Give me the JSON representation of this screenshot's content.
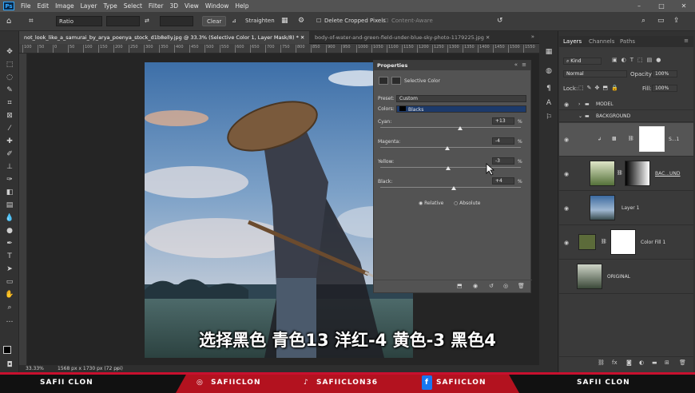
{
  "menubar": {
    "logo": "Ps",
    "items": [
      "File",
      "Edit",
      "Image",
      "Layer",
      "Type",
      "Select",
      "Filter",
      "3D",
      "View",
      "Window",
      "Help"
    ]
  },
  "options": {
    "ratio": "Ratio",
    "clear": "Clear",
    "straighten": "Straighten",
    "delete_cropped": "Delete Cropped Pixels",
    "content_aware": "Content-Aware"
  },
  "tabs": [
    "not_look_like_a_samurai_by_arya_poenya_stock_d1b8elly.jpg @ 33.3% (Selective Color 1, Layer Mask/8) *",
    "body-of-water-and-green-field-under-blue-sky-photo-1179225.jpg"
  ],
  "ruler": [
    "100",
    "50",
    "0",
    "50",
    "100",
    "150",
    "200",
    "250",
    "300",
    "350",
    "400",
    "450",
    "500",
    "550",
    "600",
    "650",
    "700",
    "750",
    "800",
    "850",
    "900",
    "950",
    "1000",
    "1050",
    "1100",
    "1150",
    "1200",
    "1250",
    "1300",
    "1350",
    "1400",
    "1450",
    "1500",
    "1550"
  ],
  "status": {
    "zoom": "33.33%",
    "doc": "1568 px x 1730 px (72 ppi)"
  },
  "properties": {
    "title": "Properties",
    "adj_name": "Selective Color",
    "preset_label": "Preset:",
    "preset_value": "Custom",
    "colors_label": "Colors:",
    "colors_value": "Blacks",
    "sliders": [
      {
        "label": "Cyan:",
        "value": "+13",
        "unit": "%",
        "pos": 0.57
      },
      {
        "label": "Magenta:",
        "value": "-4",
        "unit": "%",
        "pos": 0.48
      },
      {
        "label": "Yellow:",
        "value": "-3",
        "unit": "%",
        "pos": 0.485
      },
      {
        "label": "Black:",
        "value": "+4",
        "unit": "%",
        "pos": 0.52
      }
    ],
    "relative": "Relative",
    "absolute": "Absolute"
  },
  "layers_panel": {
    "tabs": [
      "Layers",
      "Channels",
      "Paths"
    ],
    "kind": "Kind",
    "blend": "Normal",
    "opacity_label": "Opacity:",
    "opacity": "100%",
    "lock_label": "Lock:",
    "fill_label": "Fill:",
    "fill": "100%",
    "layers": [
      {
        "name": "MODEL",
        "type": "group"
      },
      {
        "name": "BACKGROUND",
        "type": "group"
      },
      {
        "name": "S...1",
        "type": "adjustment"
      },
      {
        "name": "BAC...UND",
        "type": "image-mask"
      },
      {
        "name": "Layer 1",
        "type": "image"
      },
      {
        "name": "Color Fill 1",
        "type": "fill"
      },
      {
        "name": "ORIGINAL",
        "type": "image"
      }
    ]
  },
  "subtitle": "选择黑色 青色13 洋红-4 黄色-3 黑色4",
  "footer": {
    "left": "SAFII CLON",
    "ig": "SAFIICLON",
    "tiktok": "SAFIICLON36",
    "fb": "SAFIICLON",
    "right": "SAFII CLON"
  }
}
